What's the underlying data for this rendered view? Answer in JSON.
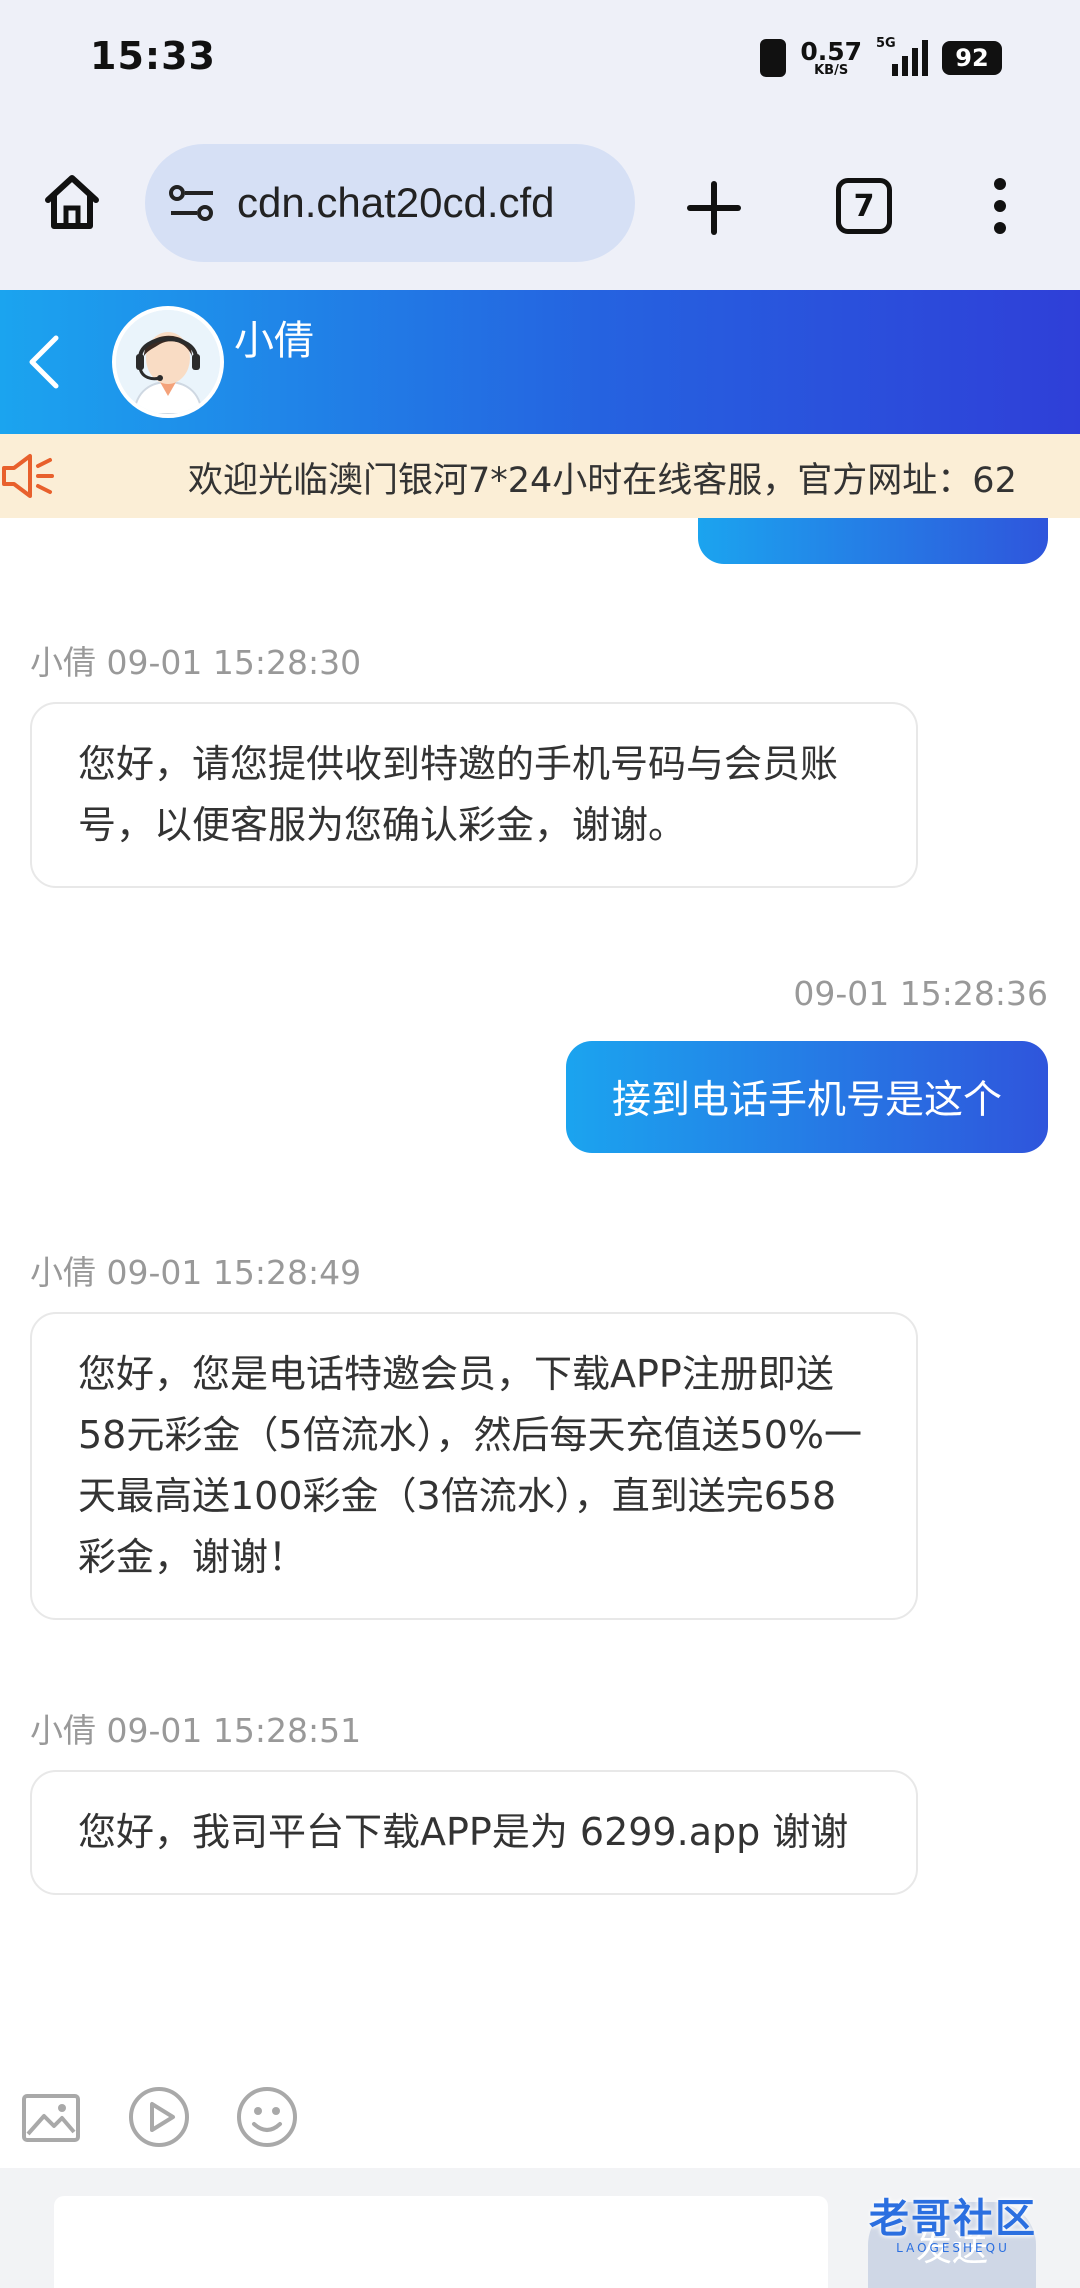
{
  "status_bar": {
    "time": "15:33",
    "net_speed": "0.57",
    "net_speed_unit": "KB/S",
    "network": "5G",
    "battery": "92"
  },
  "browser": {
    "url": "cdn.chat20cd.cfd",
    "tab_count": "7"
  },
  "chat_header": {
    "agent_name": "小倩"
  },
  "notice": {
    "text": "欢迎光临澳门银河7*24小时在线客服，官方网址：62"
  },
  "messages": [
    {
      "sender": "小倩",
      "meta": "小倩 09-01 15:28:30",
      "text": "您好，请您提供收到特邀的手机号码与会员账号，以便客服为您确认彩金，谢谢。"
    },
    {
      "sender": "me",
      "meta": "09-01 15:28:36",
      "text": "接到电话手机号是这个"
    },
    {
      "sender": "小倩",
      "meta": "小倩 09-01 15:28:49",
      "text": "您好，您是电话特邀会员，下载APP注册即送58元彩金（5倍流水），然后每天充值送50%一天最高送100彩金（3倍流水），直到送完658彩金，谢谢！"
    },
    {
      "sender": "小倩",
      "meta": "小倩 09-01 15:28:51",
      "text": "您好，我司平台下载APP是为 6299.app 谢谢"
    }
  ],
  "composer": {
    "send_label": "发送",
    "input_value": ""
  },
  "watermark": {
    "main": "老哥社区",
    "sub": "LAOGESHEQU"
  },
  "colors": {
    "header_gradient_start": "#1ba4ef",
    "header_gradient_end": "#2f3fd8",
    "notice_bg": "#fbeed6",
    "bubble_out": "#2563e0"
  }
}
